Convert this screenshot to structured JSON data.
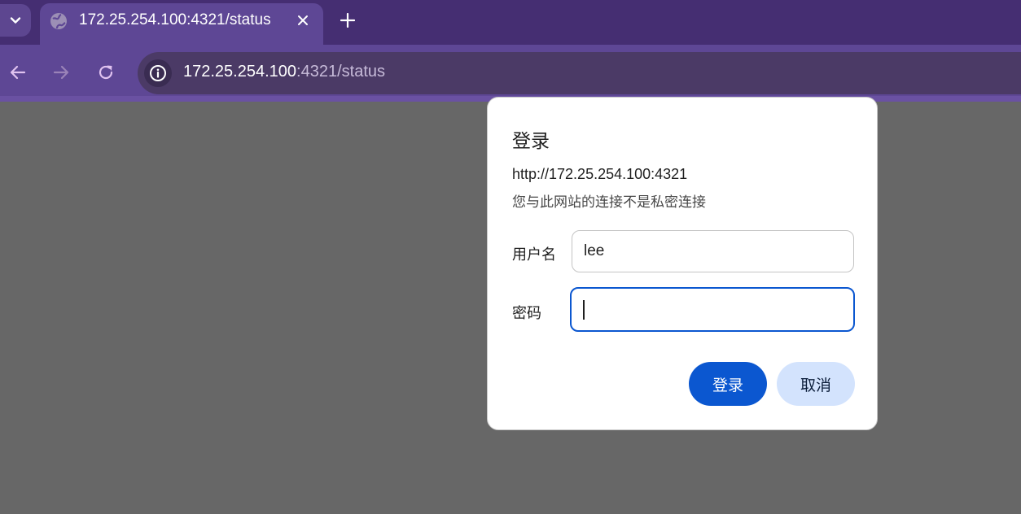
{
  "browser": {
    "tab": {
      "title": "172.25.254.100:4321/status"
    },
    "address_bar": {
      "host": "172.25.254.100",
      "rest": ":4321/status"
    }
  },
  "dialog": {
    "title": "登录",
    "origin": "http://172.25.254.100:4321",
    "warning": "您与此网站的连接不是私密连接",
    "username_label": "用户名",
    "username_value": "lee",
    "password_label": "密码",
    "password_value": "",
    "login_button": "登录",
    "cancel_button": "取消"
  },
  "colors": {
    "tabstrip": "#452e72",
    "toolbar": "#5e4795",
    "primary_button": "#0b57d0",
    "secondary_button": "#d3e3fd",
    "page_background": "#676767"
  }
}
